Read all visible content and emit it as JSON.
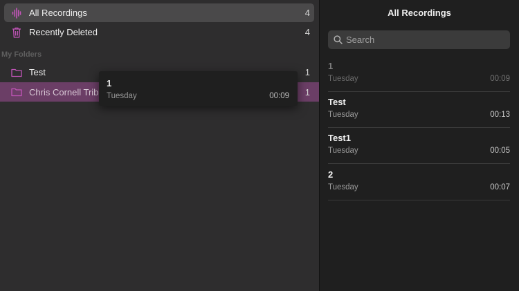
{
  "sidebar": {
    "items": [
      {
        "label": "All Recordings",
        "count": "4",
        "icon": "waveform-icon"
      },
      {
        "label": "Recently Deleted",
        "count": "4",
        "icon": "trash-icon"
      }
    ],
    "section_header": "My Folders",
    "folders": [
      {
        "label": "Test",
        "count": "1",
        "icon": "folder-icon"
      },
      {
        "label": "Chris Cornell Trib",
        "count": "1",
        "icon": "folder-icon"
      }
    ]
  },
  "drag_preview": {
    "title": "1",
    "date": "Tuesday",
    "duration": "00:09"
  },
  "list_pane": {
    "title": "All Recordings",
    "search_placeholder": "Search",
    "recordings": [
      {
        "title": "1",
        "date": "Tuesday",
        "duration": "00:09"
      },
      {
        "title": "Test",
        "date": "Tuesday",
        "duration": "00:13"
      },
      {
        "title": "Test1",
        "date": "Tuesday",
        "duration": "00:05"
      },
      {
        "title": "2",
        "date": "Tuesday",
        "duration": "00:07"
      }
    ]
  },
  "colors": {
    "accent": "#c255b8",
    "selected_folder": "#6b3e66",
    "background": "#1f1f1f"
  }
}
